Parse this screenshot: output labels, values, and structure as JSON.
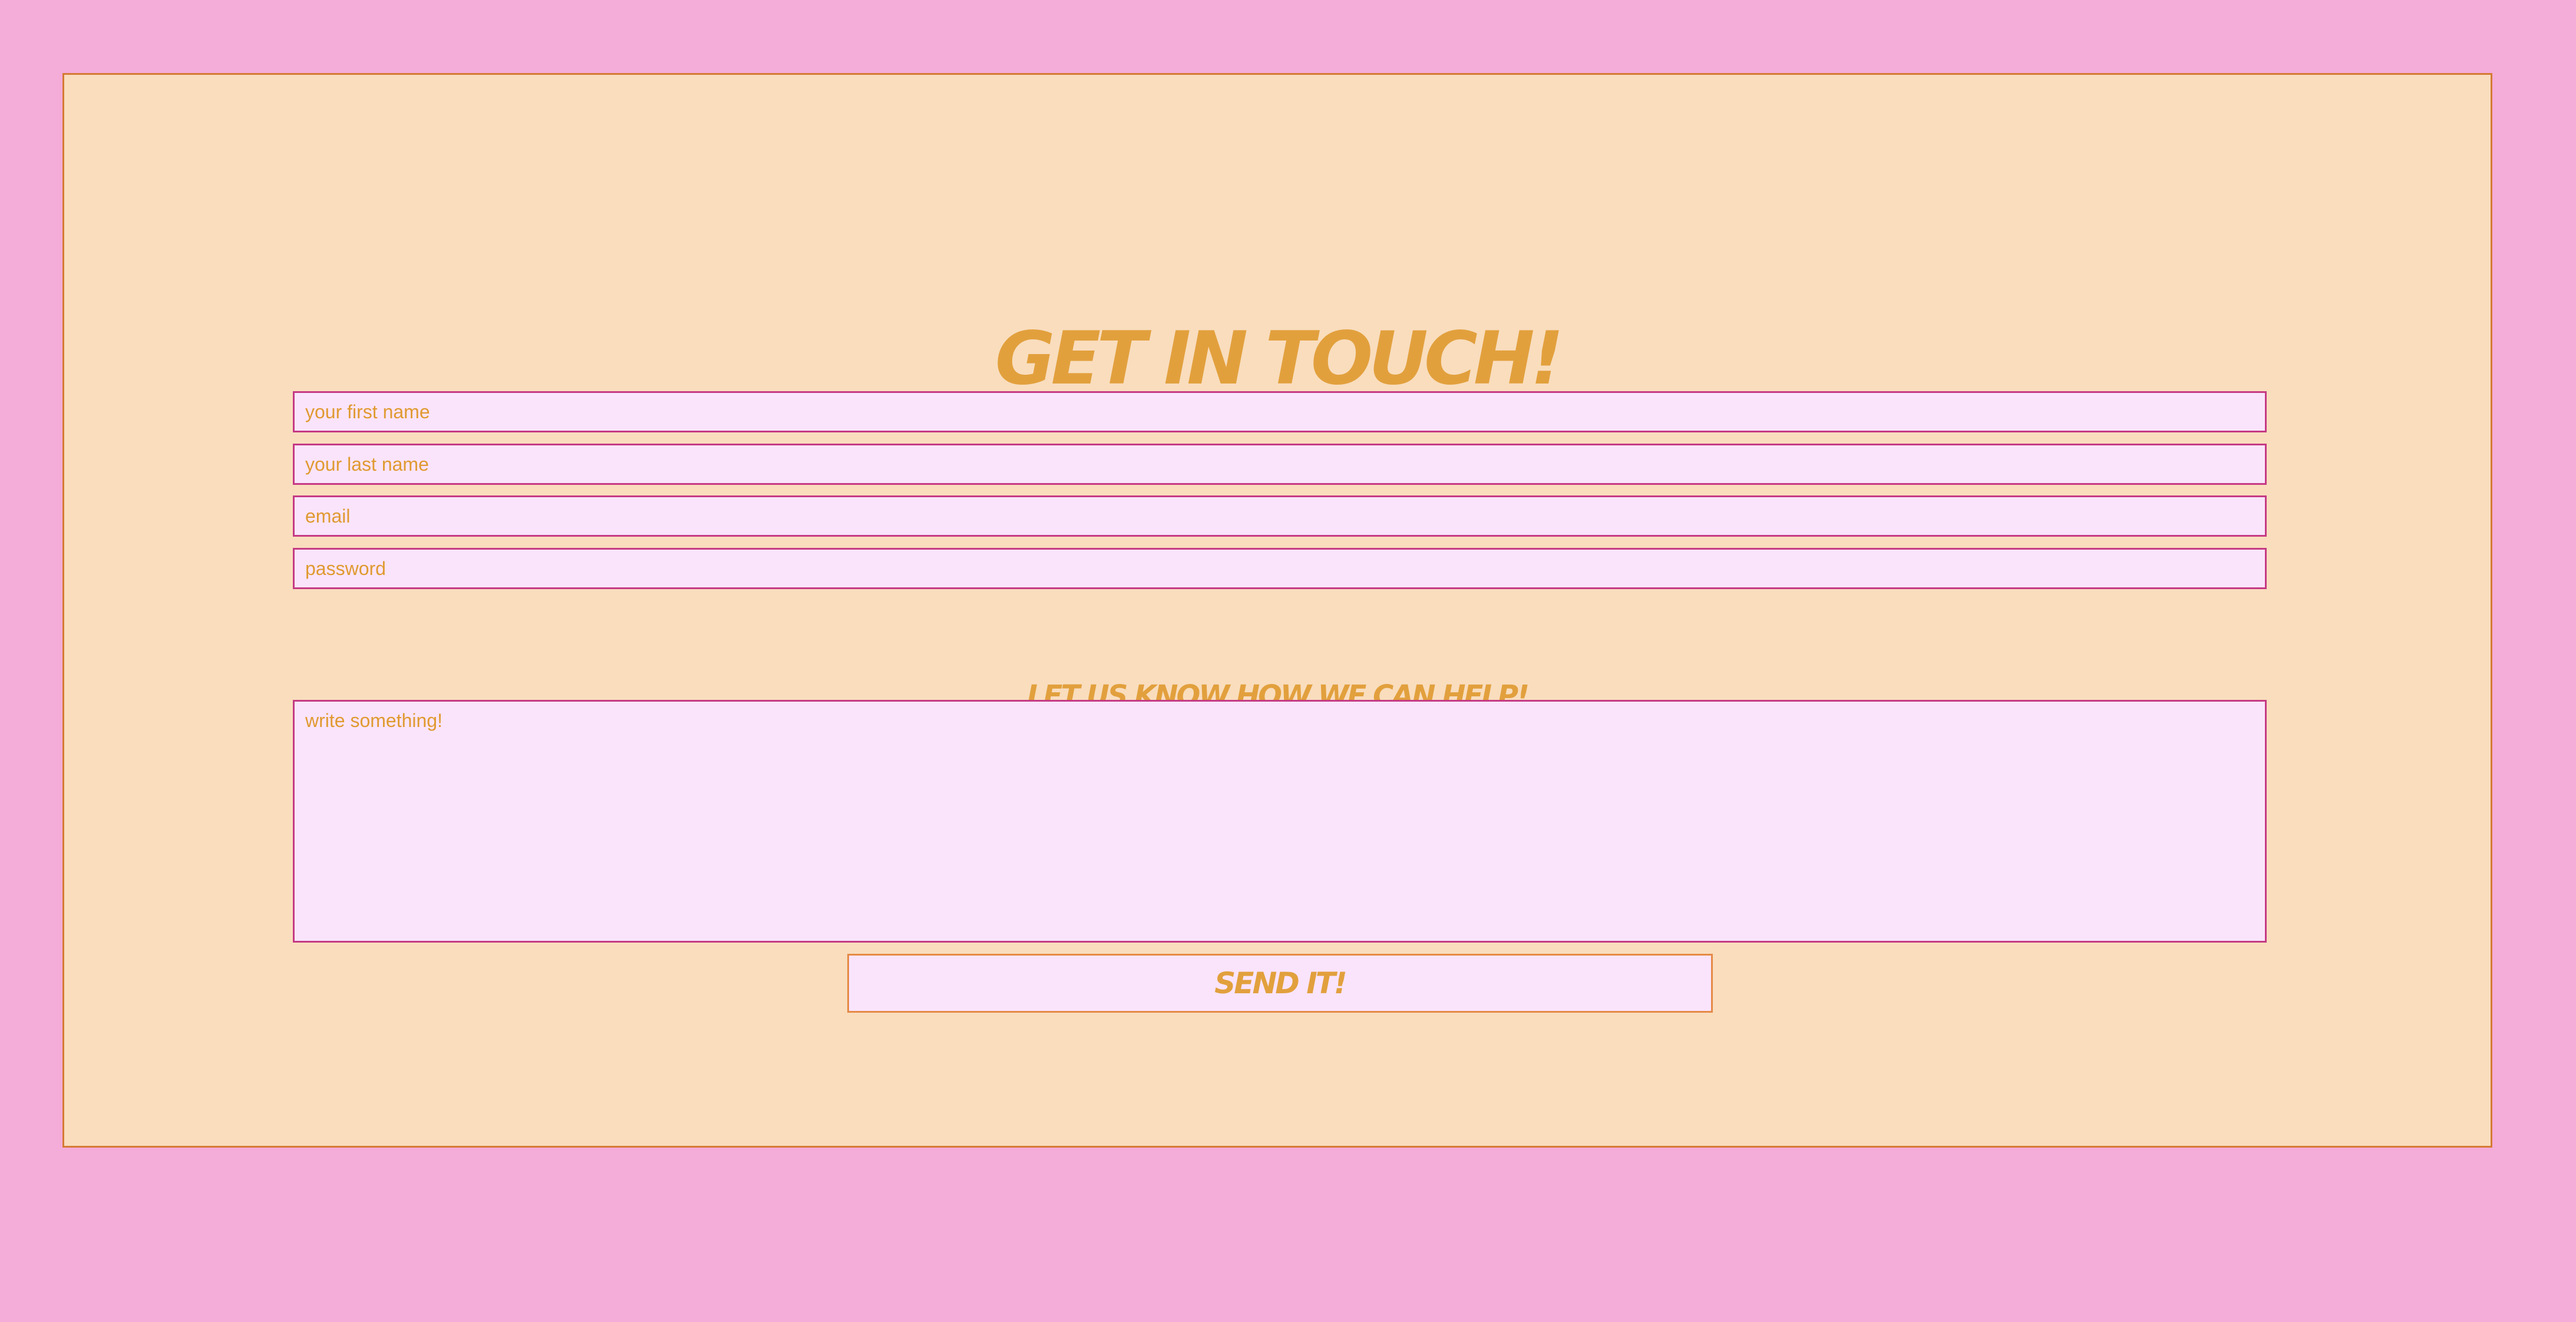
{
  "theme": {
    "page_background": "#f4acd9",
    "card_background": "#f9ddbd",
    "card_border": "#d57a35",
    "accent_text": "#e2a03d",
    "input_background": "#f9e4fc",
    "input_border": "#c53a84",
    "button_border": "#e58a46"
  },
  "form": {
    "title": "GET IN TOUCH!",
    "fields": {
      "first_name": {
        "placeholder": "your first name",
        "value": ""
      },
      "last_name": {
        "placeholder": "your last name",
        "value": ""
      },
      "email": {
        "placeholder": "email",
        "value": ""
      },
      "password": {
        "placeholder": "password",
        "value": ""
      }
    },
    "subtitle": "LET US KNOW HOW WE CAN HELP!",
    "message": {
      "placeholder": "write something!",
      "value": ""
    },
    "submit_label": "SEND IT!"
  }
}
